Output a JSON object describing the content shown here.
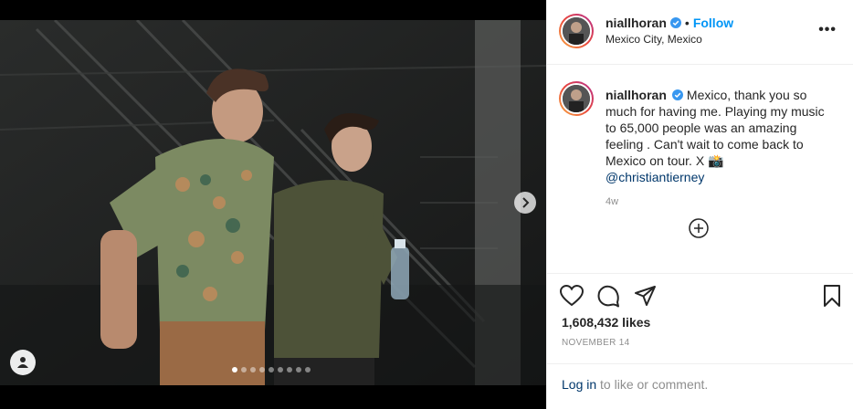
{
  "post": {
    "username": "niallhoran",
    "follow_label": "Follow",
    "separator": "•",
    "location": "Mexico City, Mexico",
    "more_label": "•••",
    "caption": "Mexico, thank you so much for having me. Playing my music to 65,000 people was an amazing feeling . Can't wait to come back to Mexico on tour. X 📸",
    "caption_mention": "@christiantierney",
    "time_ago": "4w",
    "likes": "1,608,432 likes",
    "date": "NOVEMBER 14",
    "comment_login": "Log in",
    "comment_rest": " to like or comment."
  },
  "carousel": {
    "slide_count": 9,
    "active_index": 0
  },
  "icons": {
    "verified": "verified-badge-icon",
    "like": "heart-icon",
    "comment": "comment-icon",
    "share": "share-icon",
    "save": "bookmark-icon",
    "next": "chevron-right-icon",
    "tags": "user-tag-icon",
    "add_comment": "plus-circle-icon"
  },
  "colors": {
    "link_blue": "#0095f6",
    "verified_blue": "#3897f0",
    "mention_color": "#00376b",
    "muted": "#8e8e8e"
  }
}
